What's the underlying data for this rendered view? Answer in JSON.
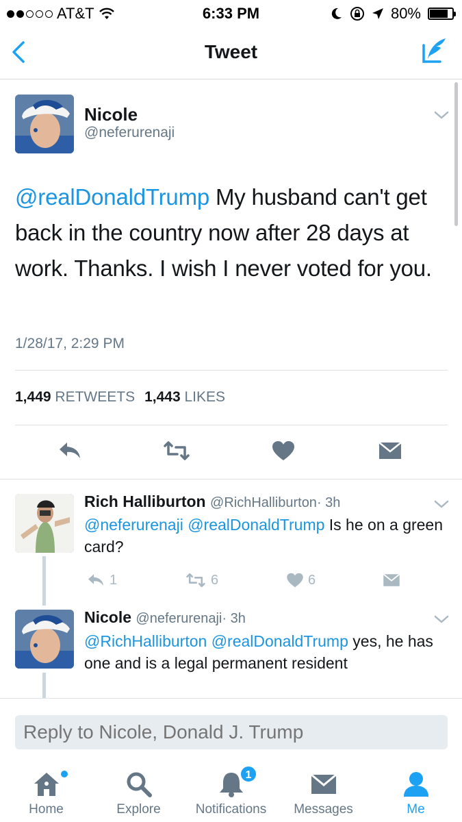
{
  "status_bar": {
    "carrier": "AT&T",
    "time": "6:33 PM",
    "battery": "80%",
    "battery_level": 0.8,
    "signal_bars": 2,
    "signal_total": 5
  },
  "nav": {
    "title": "Tweet",
    "back_icon": "chevron-left-icon",
    "compose_icon": "compose-tweet-icon",
    "accent_color": "#1da1f2"
  },
  "tweet": {
    "author_name": "Nicole",
    "author_handle": "@neferurenaji",
    "mention": "@realDonaldTrump",
    "text": " My husband can't get back in the country now after 28 days at work.  Thanks.  I wish I never voted for you.",
    "timestamp": "1/28/17, 2:29 PM",
    "retweet_count": "1,449",
    "retweet_label": "RETWEETS",
    "like_count": "1,443",
    "like_label": "LIKES"
  },
  "replies": [
    {
      "author_name": "Rich Halliburton",
      "author_handle": "@RichHalliburton",
      "time_ago": "· 3h",
      "mentions": "@neferurenaji @realDonaldTrump",
      "text": " Is he on a green card?",
      "reply_count": "1",
      "retweet_count": "6",
      "like_count": "6"
    },
    {
      "author_name": "Nicole",
      "author_handle": "@neferurenaji",
      "time_ago": "· 3h",
      "mentions": "@RichHalliburton @realDonaldTrump",
      "text": " yes, he has one and is a legal permanent resident"
    }
  ],
  "reply_box": {
    "placeholder": "Reply to Nicole, Donald J. Trump"
  },
  "tab_bar": {
    "tabs": [
      {
        "label": "Home",
        "icon": "home-icon"
      },
      {
        "label": "Explore",
        "icon": "search-icon"
      },
      {
        "label": "Notifications",
        "icon": "bell-icon",
        "badge": "1"
      },
      {
        "label": "Messages",
        "icon": "envelope-icon"
      },
      {
        "label": "Me",
        "icon": "person-icon",
        "active": true
      }
    ]
  }
}
